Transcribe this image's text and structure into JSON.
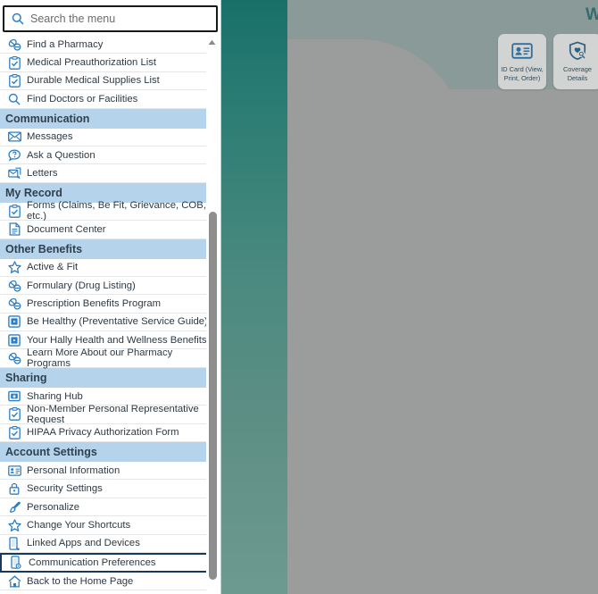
{
  "search": {
    "placeholder": "Search the menu",
    "value": "",
    "icon": "search-icon"
  },
  "hero": {
    "welcome_text": "W",
    "tiles": [
      {
        "label": "ID Card (View, Print, Order)",
        "icon": "id-card-icon"
      },
      {
        "label": "Coverage Details",
        "icon": "shield-heart-search-icon"
      }
    ]
  },
  "menu": {
    "groups": [
      {
        "header": null,
        "items": [
          {
            "label": "Find a Pharmacy",
            "icon": "pills-icon"
          },
          {
            "label": "Medical Preauthorization List",
            "icon": "clipboard-check-icon"
          },
          {
            "label": "Durable Medical Supplies List",
            "icon": "clipboard-check-icon"
          },
          {
            "label": "Find Doctors or Facilities",
            "icon": "search-icon"
          }
        ]
      },
      {
        "header": "Communication",
        "items": [
          {
            "label": "Messages",
            "icon": "envelope-icon"
          },
          {
            "label": "Ask a Question",
            "icon": "question-bubble-icon"
          },
          {
            "label": "Letters",
            "icon": "letters-icon"
          }
        ]
      },
      {
        "header": "My Record",
        "items": [
          {
            "label": "Forms (Claims, Be Fit, Grievance, COB, etc.)",
            "icon": "clipboard-check-icon"
          },
          {
            "label": "Document Center",
            "icon": "document-icon"
          }
        ]
      },
      {
        "header": "Other Benefits",
        "items": [
          {
            "label": "Active & Fit",
            "icon": "star-icon"
          },
          {
            "label": "Formulary (Drug Listing)",
            "icon": "pills-icon"
          },
          {
            "label": "Prescription Benefits Program",
            "icon": "pills-icon"
          },
          {
            "label": "Be Healthy (Preventative Service Guide)",
            "icon": "play-box-icon"
          },
          {
            "label": "Your Hally Health and Wellness Benefits",
            "icon": "play-box-icon"
          },
          {
            "label": "Learn More About our Pharmacy Programs",
            "icon": "pills-icon"
          }
        ]
      },
      {
        "header": "Sharing",
        "items": [
          {
            "label": "Sharing Hub",
            "icon": "share-box-icon"
          },
          {
            "label": "Non-Member Personal Representative Request",
            "icon": "clipboard-check-icon"
          },
          {
            "label": "HIPAA Privacy Authorization Form",
            "icon": "clipboard-check-icon"
          }
        ]
      },
      {
        "header": "Account Settings",
        "items": [
          {
            "label": "Personal Information",
            "icon": "id-card-icon"
          },
          {
            "label": "Security Settings",
            "icon": "lock-icon"
          },
          {
            "label": "Personalize",
            "icon": "paintbrush-icon"
          },
          {
            "label": "Change Your Shortcuts",
            "icon": "star-icon"
          },
          {
            "label": "Linked Apps and Devices",
            "icon": "device-link-icon"
          },
          {
            "label": "Communication Preferences",
            "icon": "device-gear-icon",
            "focused": true
          },
          {
            "label": "Back to the Home Page",
            "icon": "home-icon"
          }
        ]
      }
    ]
  },
  "scrollbar": {
    "up_arrow": "caret-up-icon"
  },
  "colors": {
    "section_header_bg": "#b5d3ea",
    "teal_band": "#2b7d73",
    "overlay_grey": "#9a9d9c",
    "focus_outline": "#153a5b",
    "icon_blue": "#2e7ec4"
  }
}
